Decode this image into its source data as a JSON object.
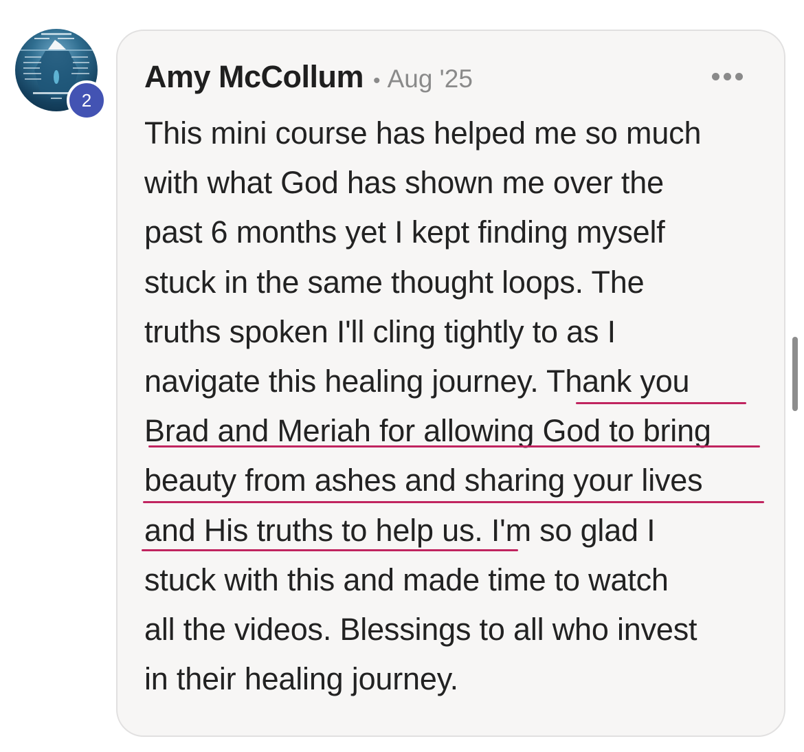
{
  "avatar": {
    "icon": "iceberg-image-avatar",
    "badge_count": "2"
  },
  "comment": {
    "author": "Amy McCollum",
    "separator": "•",
    "date": "Aug '25",
    "more_icon": "more-horizontal-icon",
    "lines": [
      "This mini course has helped me so much",
      "with what God has shown me over the",
      "past 6 months yet I kept finding myself",
      "stuck in the same thought loops. The",
      "truths spoken I'll cling tightly to as I",
      "navigate this healing journey. Thank you",
      "Brad and Meriah for allowing God to bring",
      "beauty from ashes and sharing your lives",
      "and His truths to help us. I'm so glad I",
      "stuck with this and made time to watch",
      "all the videos. Blessings to all who invest",
      "in their healing journey."
    ],
    "highlight_color": "#c0245f"
  },
  "colors": {
    "bubble_bg": "#f7f6f5",
    "badge_bg": "#4353b3",
    "text": "#222222",
    "meta": "#8a8a8a"
  }
}
